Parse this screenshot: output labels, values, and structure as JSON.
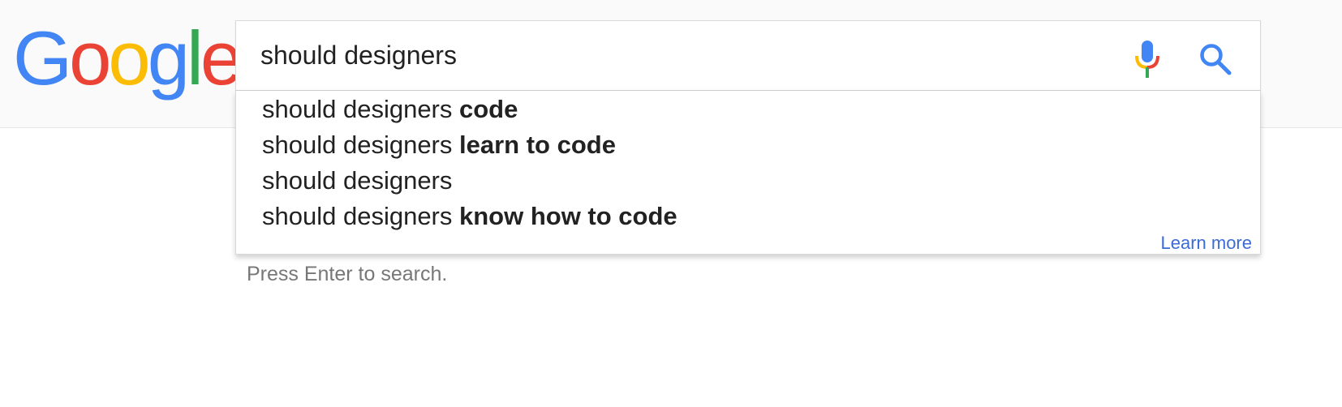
{
  "logo": {
    "letters": [
      "G",
      "o",
      "o",
      "g",
      "l",
      "e"
    ],
    "colors": [
      "#4285F4",
      "#EA4335",
      "#FBBC05",
      "#4285F4",
      "#34A853",
      "#EA4335"
    ]
  },
  "search": {
    "value": "should designers",
    "mic_icon": "microphone-icon",
    "search_icon": "magnifier-icon",
    "accent": "#4285F4"
  },
  "suggestions": [
    {
      "prefix": "should designers ",
      "bold": "code"
    },
    {
      "prefix": "should designers ",
      "bold": "learn to code"
    },
    {
      "prefix": "should designers",
      "bold": ""
    },
    {
      "prefix": "should designers ",
      "bold": "know how to code"
    }
  ],
  "learn_more": "Learn more",
  "hint": "Press Enter to search."
}
